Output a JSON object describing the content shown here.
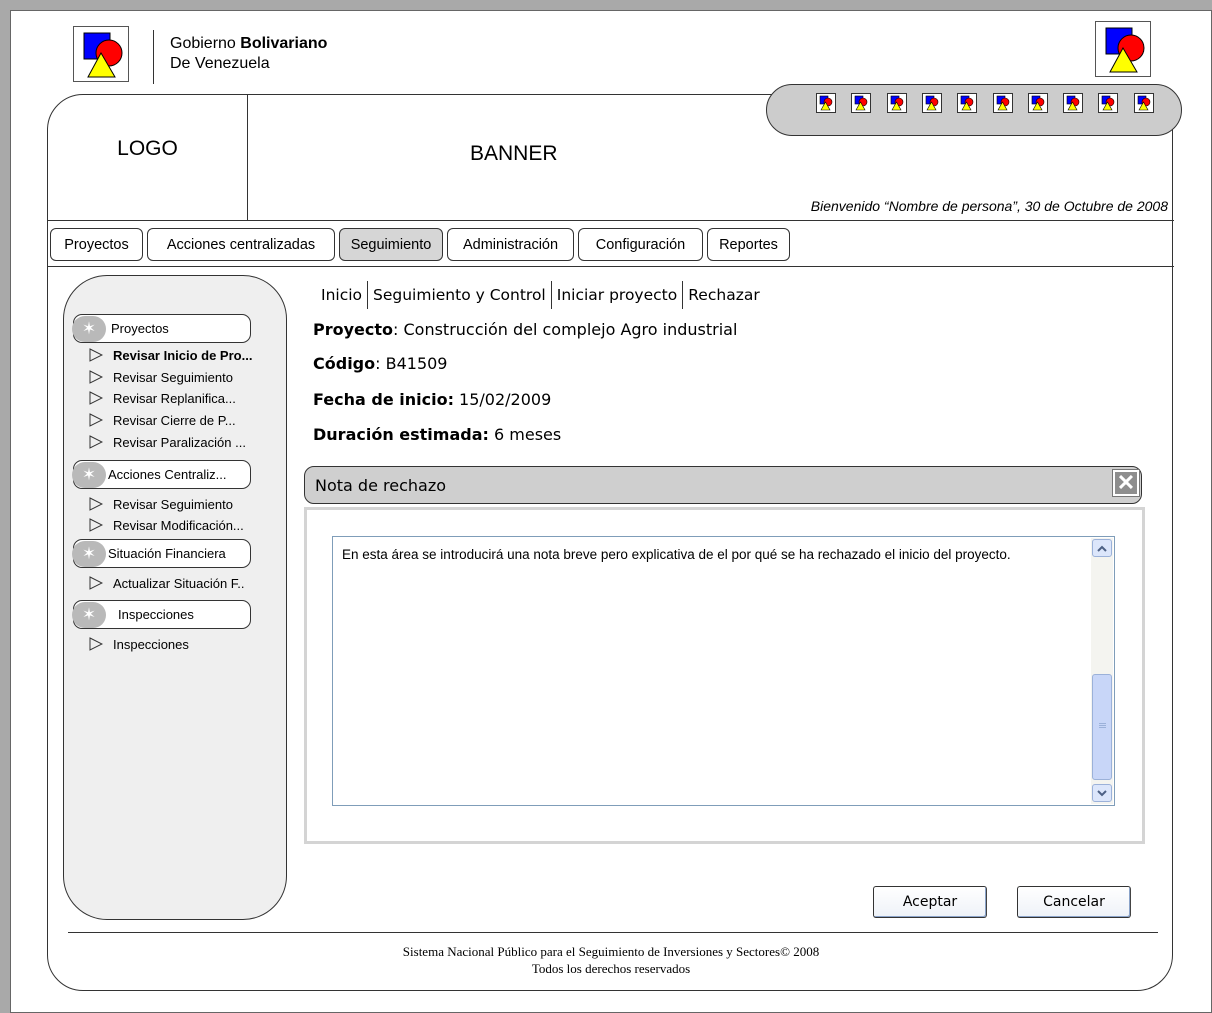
{
  "government": {
    "name_prefix": "Gobierno ",
    "name_bold": "Bolivariano",
    "name_line2": "De Venezuela"
  },
  "header": {
    "logo_label": "LOGO",
    "banner_label": "BANNER",
    "welcome": "Bienvenido “Nombre de persona”, 30 de Octubre de 2008"
  },
  "tabs": [
    {
      "label": "Proyectos"
    },
    {
      "label": "Acciones centralizadas"
    },
    {
      "label": "Seguimiento"
    },
    {
      "label": "Administración"
    },
    {
      "label": "Configuración"
    },
    {
      "label": "Reportes"
    }
  ],
  "sidebar": {
    "groups": [
      {
        "label": "Proyectos",
        "items": [
          "Revisar Inicio de Pro...",
          "Revisar Seguimiento",
          "Revisar Replanifica...",
          "Revisar Cierre de P...",
          "Revisar Paralización ..."
        ]
      },
      {
        "label": "Acciones Centraliz...",
        "items": [
          "Revisar Seguimiento",
          "Revisar Modificación..."
        ]
      },
      {
        "label": "Situación Financiera",
        "items": [
          "Actualizar Situación F.."
        ]
      },
      {
        "label": "Inspecciones",
        "items": [
          "Inspecciones"
        ]
      }
    ]
  },
  "breadcrumb": [
    "Inicio",
    "Seguimiento y Control",
    "Iniciar proyecto",
    "Rechazar"
  ],
  "project": {
    "name_label": "Proyecto",
    "name_value": ":  Construcción del complejo Agro industrial",
    "code_label": "Código",
    "code_value": ": B41509",
    "start_label": "Fecha de inicio:",
    "start_value": " 15/02/2009",
    "duration_label": "Duración estimada:",
    "duration_value": " 6 meses"
  },
  "modal": {
    "title": "Nota de rechazo",
    "close_glyph": "✕",
    "note_text": "En esta área se introducirá una nota breve pero explicativa de el por qué se ha rechazado el inicio del proyecto."
  },
  "buttons": {
    "accept": "Aceptar",
    "cancel": "Cancelar"
  },
  "footer": {
    "line1": "Sistema Nacional Público para el Seguimiento de Inversiones y Sectores© 2008",
    "line2": "Todos los derechos reservados"
  },
  "icons": {
    "gov_logo": "shapes-logo-icon",
    "toolbar_icon": "shapes-mini-icon",
    "group_icon": "star-icon",
    "nav_item_icon": "triangle-right-icon"
  },
  "colors": {
    "background": "#a9a9a9",
    "logo_blue": "#0000ff",
    "logo_red": "#ff0000",
    "logo_yellow": "#ffff00",
    "active_tab": "#d6d6d6",
    "sidebar_bg": "#efefef"
  }
}
